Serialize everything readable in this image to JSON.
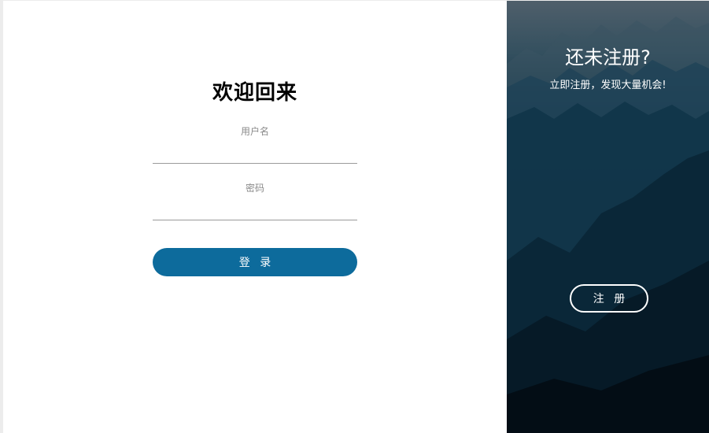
{
  "login": {
    "title": "欢迎回来",
    "username_label": "用户名",
    "username_value": "",
    "password_label": "密码",
    "password_value": "",
    "submit_label": "登 录"
  },
  "register": {
    "title": "还未注册?",
    "subtitle": "立即注册，发现大量机会!",
    "button_label": "注 册"
  },
  "colors": {
    "primary_button": "#0d6b9c",
    "panel_dark": "#0a2a3b"
  }
}
